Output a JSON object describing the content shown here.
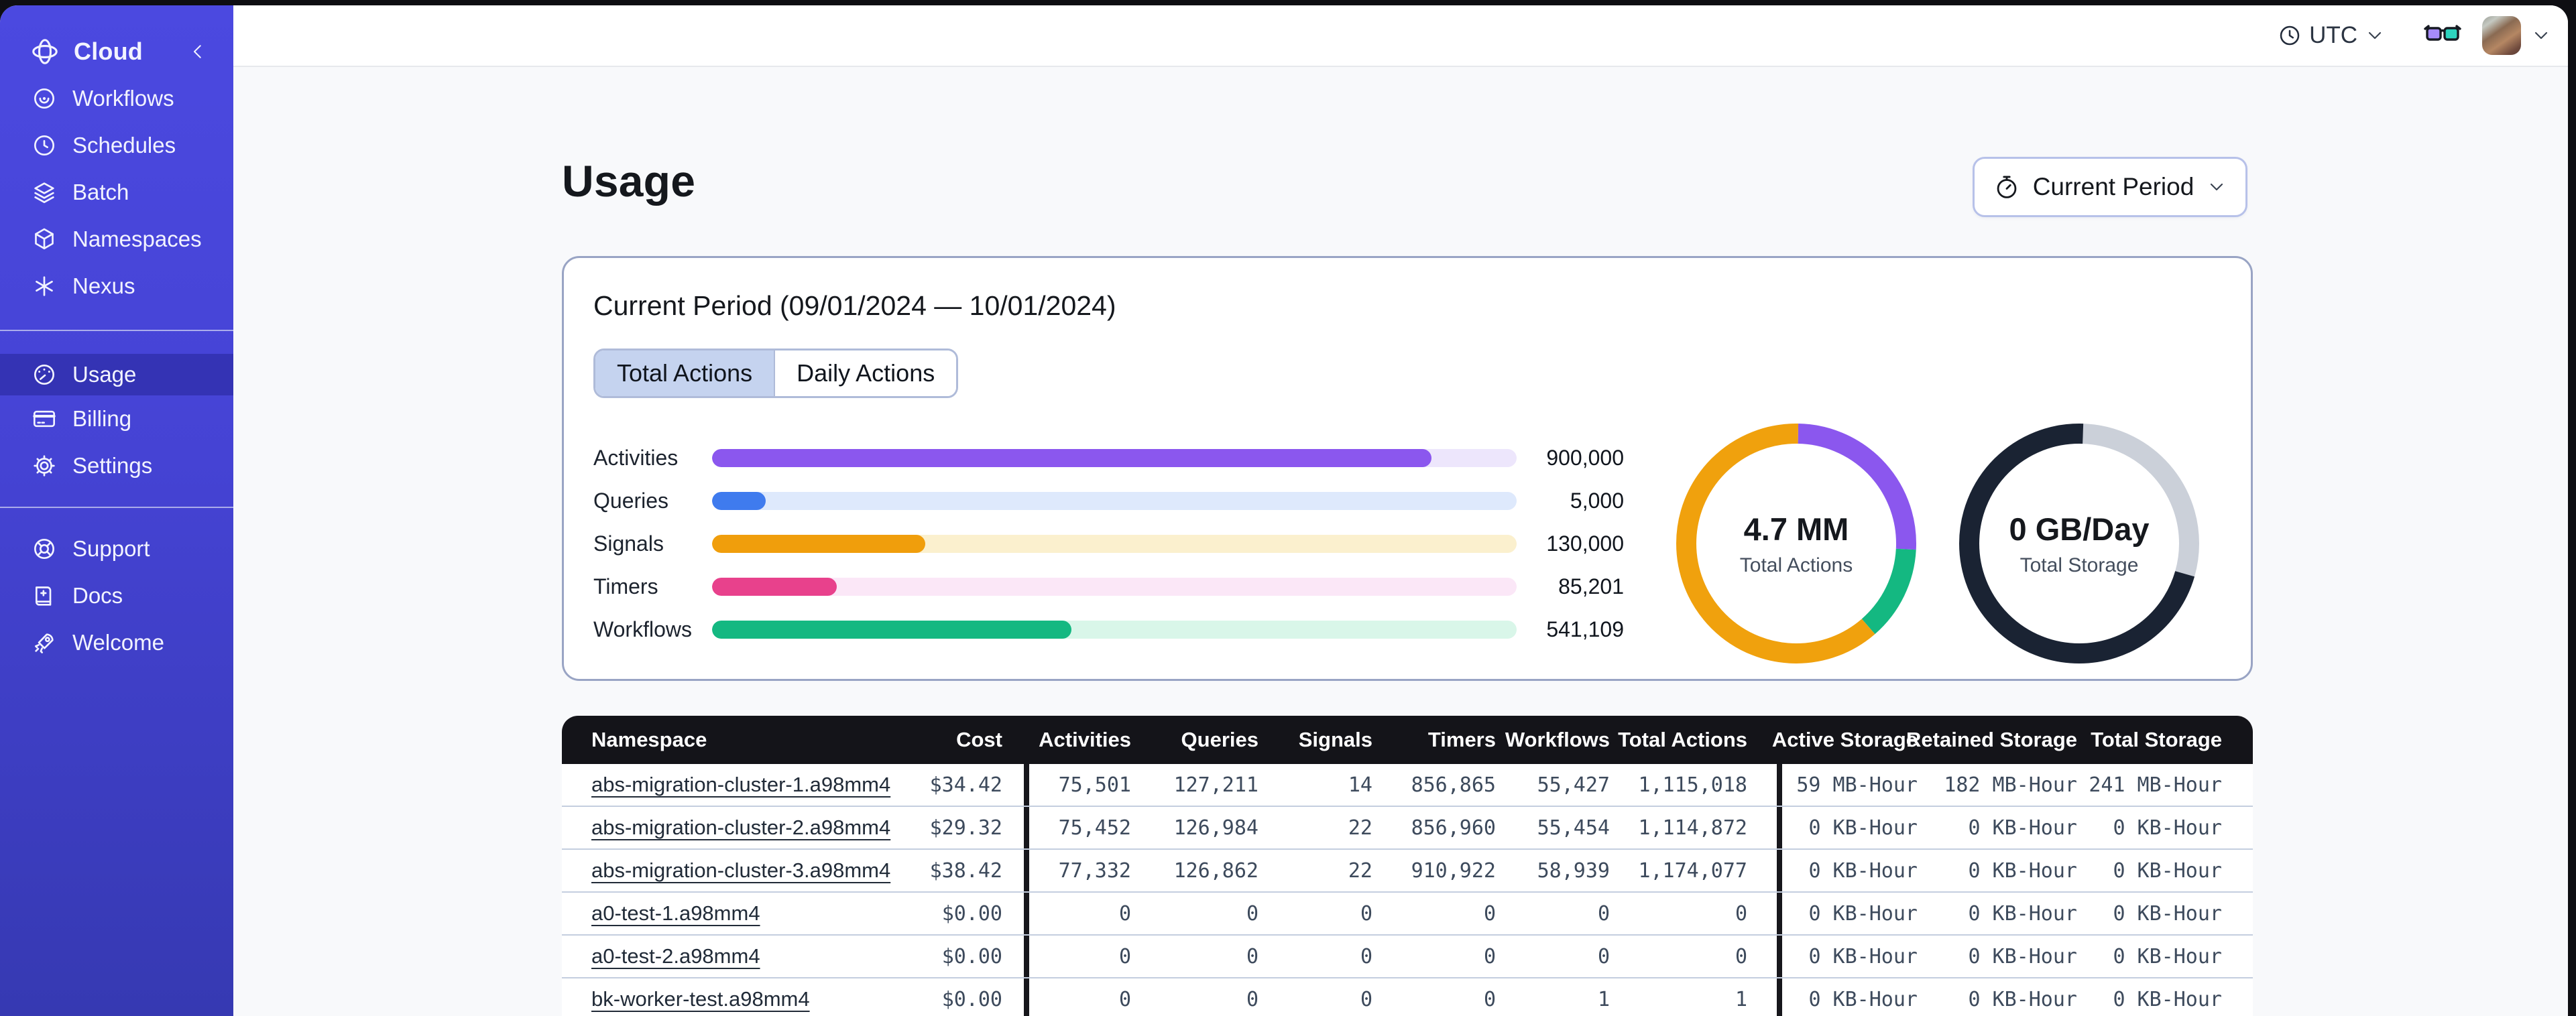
{
  "sidebar": {
    "brand": {
      "label": "Cloud"
    },
    "nav_main": [
      {
        "label": "Workflows",
        "icon": "workflows-icon"
      },
      {
        "label": "Schedules",
        "icon": "schedules-icon"
      },
      {
        "label": "Batch",
        "icon": "batch-icon"
      },
      {
        "label": "Namespaces",
        "icon": "namespaces-icon"
      },
      {
        "label": "Nexus",
        "icon": "nexus-icon"
      }
    ],
    "nav_account": [
      {
        "label": "Usage",
        "icon": "usage-icon",
        "active": true
      },
      {
        "label": "Billing",
        "icon": "billing-icon"
      },
      {
        "label": "Settings",
        "icon": "settings-icon"
      }
    ],
    "nav_footer": [
      {
        "label": "Support",
        "icon": "support-icon"
      },
      {
        "label": "Docs",
        "icon": "docs-icon"
      },
      {
        "label": "Welcome",
        "icon": "welcome-icon"
      }
    ]
  },
  "topbar": {
    "timezone": "UTC"
  },
  "page": {
    "title": "Usage",
    "period_button_label": "Current Period"
  },
  "usage_card": {
    "title": "Current Period (09/01/2024 — 10/01/2024)",
    "tabs": [
      {
        "label": "Total Actions",
        "active": true
      },
      {
        "label": "Daily Actions",
        "active": false
      }
    ],
    "bars": [
      {
        "label": "Activities",
        "value": "900,000",
        "percent": 89.4,
        "fill": "#8B57EE",
        "track": "#EDE6FC"
      },
      {
        "label": "Queries",
        "value": "5,000",
        "percent": 6.7,
        "fill": "#3F7BEE",
        "track": "#DEE9FC"
      },
      {
        "label": "Signals",
        "value": "130,000",
        "percent": 26.5,
        "fill": "#F09E0C",
        "track": "#FBF0CE"
      },
      {
        "label": "Timers",
        "value": "85,201",
        "percent": 15.5,
        "fill": "#E8418C",
        "track": "#FBE7F7"
      },
      {
        "label": "Workflows",
        "value": "541,109",
        "percent": 44.7,
        "fill": "#14B881",
        "track": "#D9F6E9"
      }
    ],
    "donuts": [
      {
        "value": "4.7 MM",
        "label": "Total Actions",
        "segments": [
          {
            "color": "#8B57EE",
            "from": 1,
            "to": 93
          },
          {
            "color": "#14B881",
            "from": 93,
            "to": 139
          },
          {
            "color": "#F0A10D",
            "from": 139,
            "to": 361
          }
        ]
      },
      {
        "value": "0 GB/Day",
        "label": "Total Storage",
        "segments": [
          {
            "color": "#CBD0D9",
            "from": 2,
            "to": 106
          },
          {
            "color": "#1A2333",
            "from": 106,
            "to": 362
          }
        ]
      }
    ]
  },
  "table": {
    "columns": [
      "Namespace",
      "Cost",
      "Activities",
      "Queries",
      "Signals",
      "Timers",
      "Workflows",
      "Total Actions",
      "Active Storage",
      "Retained Storage",
      "Total Storage"
    ],
    "rows": [
      [
        "abs-migration-cluster-1.a98mm4",
        "$34.42",
        "75,501",
        "127,211",
        "14",
        "856,865",
        "55,427",
        "1,115,018",
        "59 MB-Hour",
        "182 MB-Hour",
        "241 MB-Hour"
      ],
      [
        "abs-migration-cluster-2.a98mm4",
        "$29.32",
        "75,452",
        "126,984",
        "22",
        "856,960",
        "55,454",
        "1,114,872",
        "0 KB-Hour",
        "0 KB-Hour",
        "0 KB-Hour"
      ],
      [
        "abs-migration-cluster-3.a98mm4",
        "$38.42",
        "77,332",
        "126,862",
        "22",
        "910,922",
        "58,939",
        "1,174,077",
        "0 KB-Hour",
        "0 KB-Hour",
        "0 KB-Hour"
      ],
      [
        "a0-test-1.a98mm4",
        "$0.00",
        "0",
        "0",
        "0",
        "0",
        "0",
        "0",
        "0 KB-Hour",
        "0 KB-Hour",
        "0 KB-Hour"
      ],
      [
        "a0-test-2.a98mm4",
        "$0.00",
        "0",
        "0",
        "0",
        "0",
        "0",
        "0",
        "0 KB-Hour",
        "0 KB-Hour",
        "0 KB-Hour"
      ],
      [
        "bk-worker-test.a98mm4",
        "$0.00",
        "0",
        "0",
        "0",
        "0",
        "1",
        "1",
        "0 KB-Hour",
        "0 KB-Hour",
        "0 KB-Hour"
      ]
    ]
  },
  "chart_data": [
    {
      "type": "bar",
      "title": "Current Period action totals",
      "categories": [
        "Activities",
        "Queries",
        "Signals",
        "Timers",
        "Workflows"
      ],
      "values": [
        900000,
        5000,
        130000,
        85201,
        541109
      ],
      "xlabel": "",
      "ylabel": "Actions"
    },
    {
      "type": "pie",
      "title": "Total Actions",
      "center_value": "4.7 MM",
      "slices": [
        {
          "name": "purple-segment",
          "percent": 25.6,
          "color": "#8B57EE"
        },
        {
          "name": "green-segment",
          "percent": 12.8,
          "color": "#14B881"
        },
        {
          "name": "orange-segment",
          "percent": 61.6,
          "color": "#F0A10D"
        }
      ]
    },
    {
      "type": "pie",
      "title": "Total Storage",
      "center_value": "0 GB/Day",
      "slices": [
        {
          "name": "gray-segment",
          "percent": 28.9,
          "color": "#CBD0D9"
        },
        {
          "name": "dark-segment",
          "percent": 71.1,
          "color": "#1A2333"
        }
      ]
    }
  ]
}
